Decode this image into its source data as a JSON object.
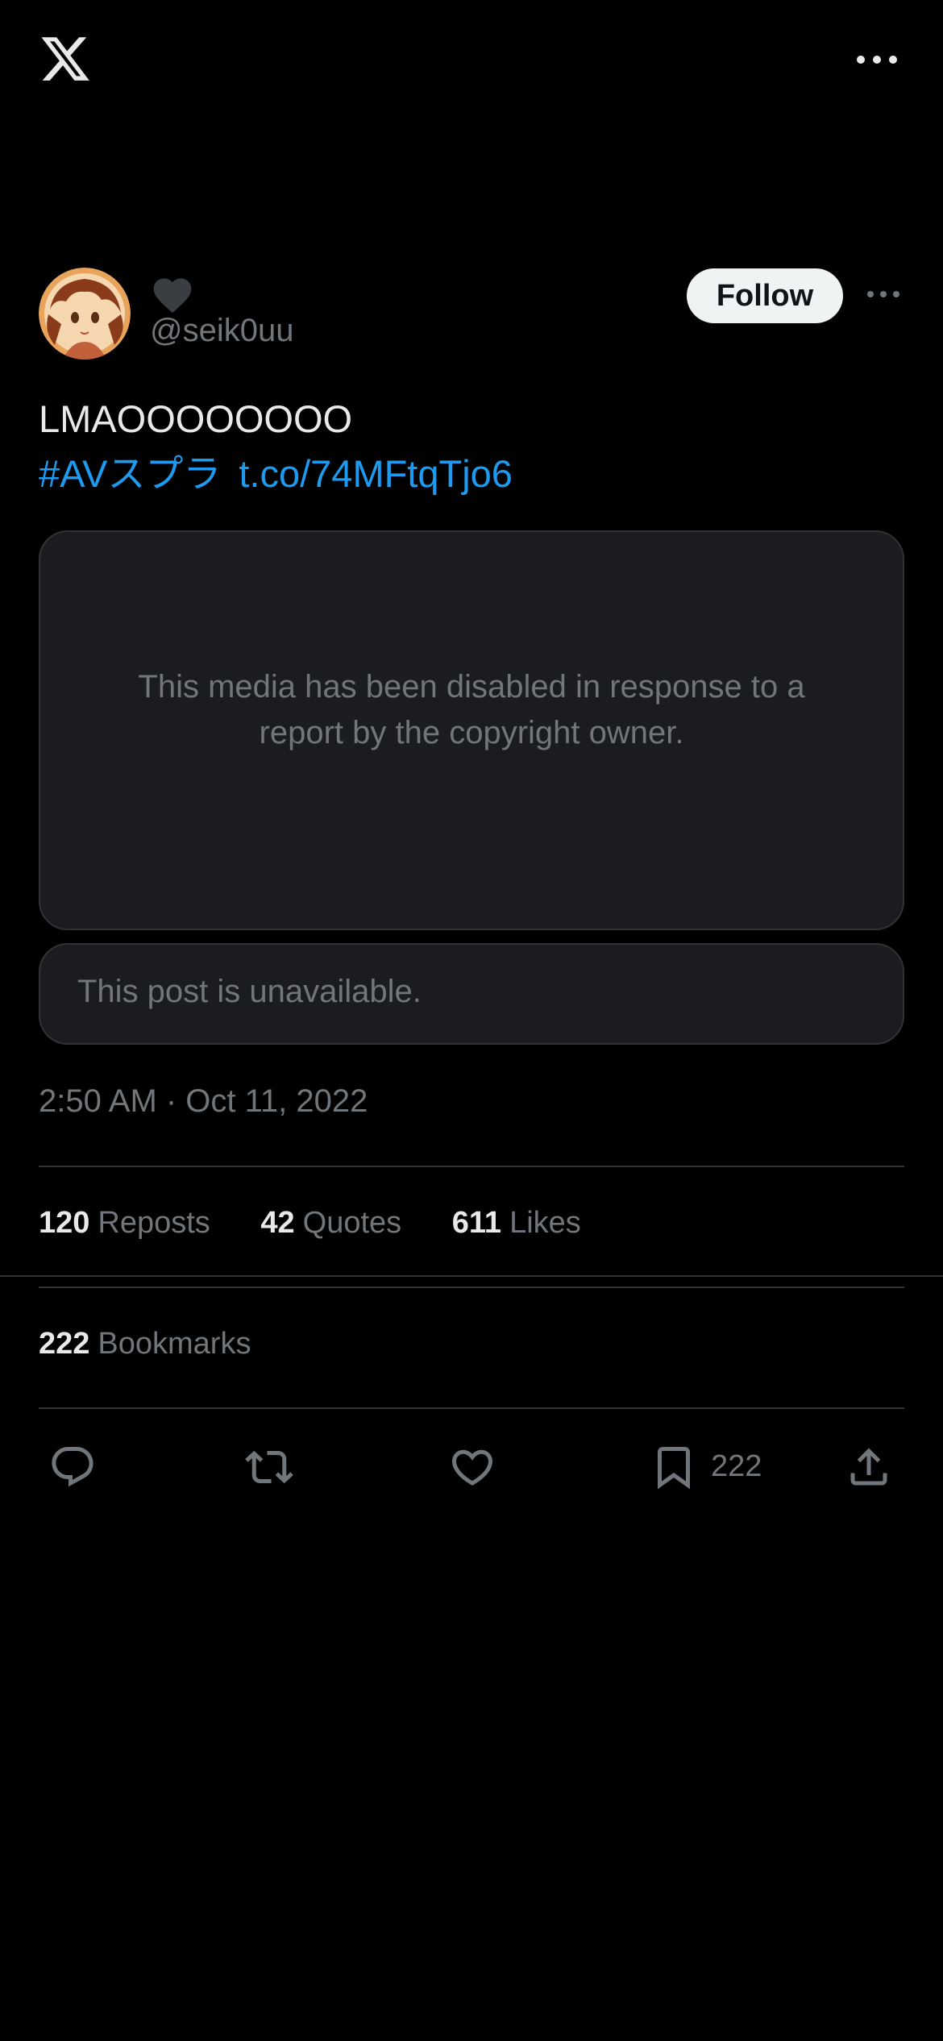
{
  "app": {
    "logo_icon": "x-logo-icon",
    "menu_icon": "more-horizontal-icon"
  },
  "author": {
    "handle": "@seik0uu",
    "badge_icon": "heart-icon",
    "follow_label": "Follow"
  },
  "post": {
    "text": "LMAOOOOOOOO",
    "hashtag": "#AVスプラ",
    "link": "t.co/74MFtqTjo6",
    "media_notice": "This media has been disabled in response to a report by the copyright owner.",
    "quote_notice": "This post is unavailable.",
    "timestamp": "2:50 AM · Oct 11, 2022"
  },
  "stats": {
    "reposts": {
      "count": "120",
      "label": "Reposts"
    },
    "quotes": {
      "count": "42",
      "label": "Quotes"
    },
    "likes": {
      "count": "611",
      "label": "Likes"
    },
    "bookmarks": {
      "count": "222",
      "label": "Bookmarks"
    }
  },
  "actions": {
    "reply_icon": "reply-icon",
    "repost_icon": "repost-icon",
    "like_icon": "like-icon",
    "bookmark_icon": "bookmark-icon",
    "bookmark_count": "222",
    "share_icon": "share-icon"
  },
  "colors": {
    "background": "#000000",
    "text_primary": "#e7e9ea",
    "text_secondary": "#71767b",
    "link": "#1d9bf0",
    "follow_bg": "#eff3f4",
    "card_bg": "#1b1c1f",
    "border": "#2f3336"
  }
}
